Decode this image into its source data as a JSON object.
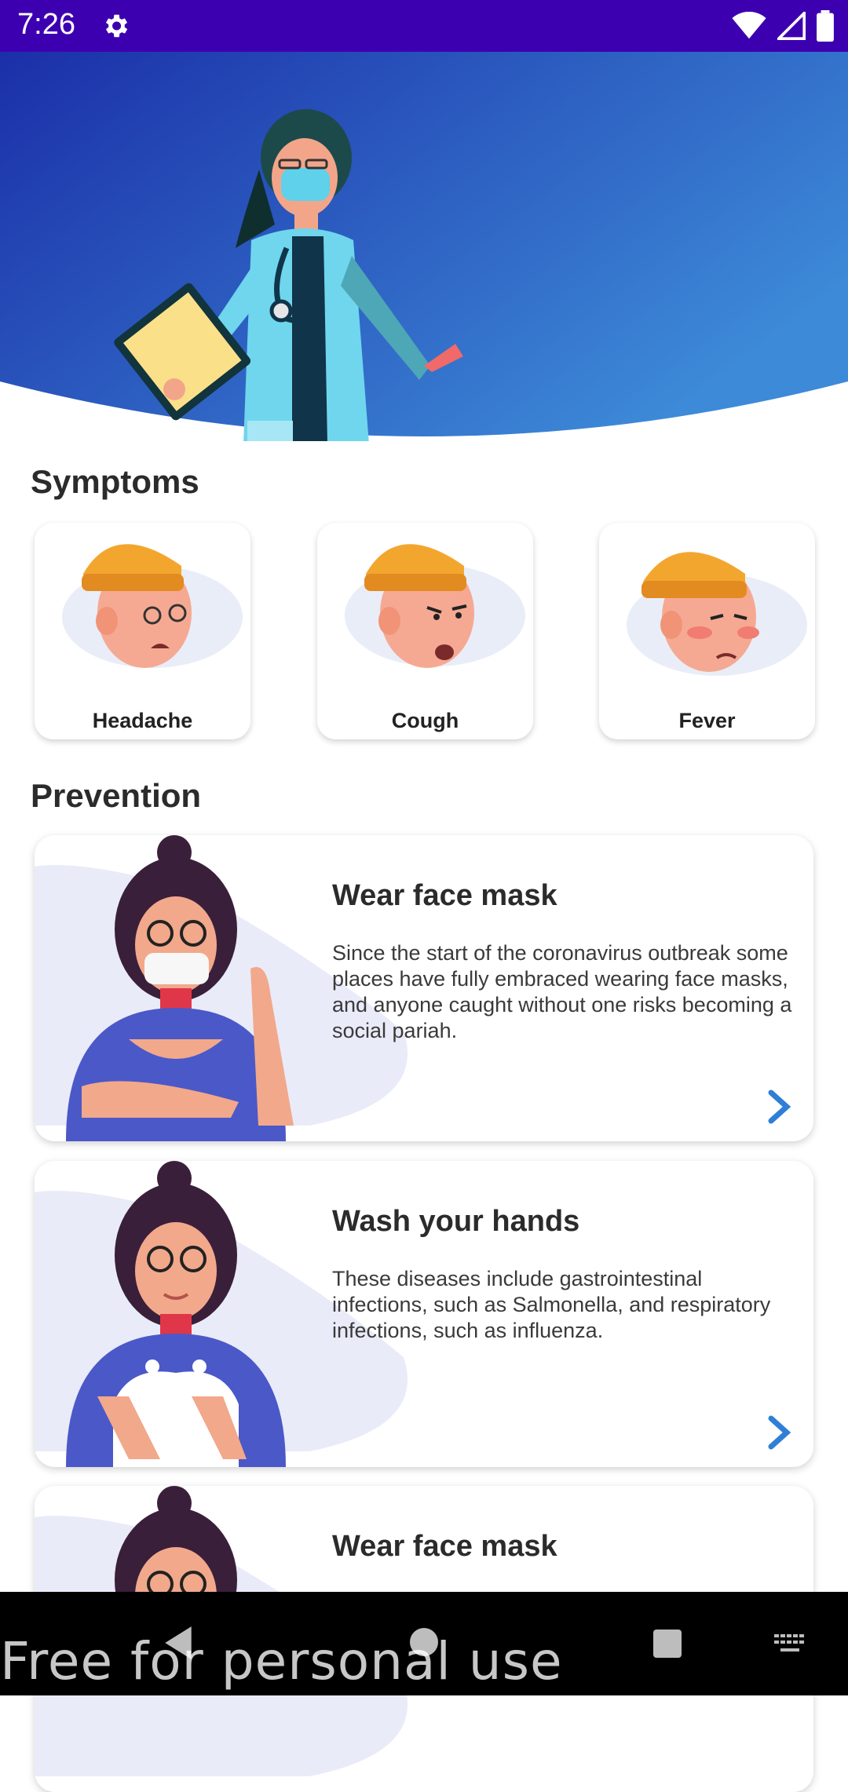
{
  "status_bar": {
    "time": "7:26",
    "icons": [
      "settings-gear-icon",
      "wifi-icon",
      "signal-icon",
      "battery-icon"
    ],
    "background": "#3d00b0"
  },
  "header": {
    "illustration": "doctor-with-clipboard-and-mask",
    "gradient": [
      "#1b2fa8",
      "#3d8ad8"
    ]
  },
  "symptoms": {
    "title": "Symptoms",
    "items": [
      {
        "label": "Headache",
        "illustration": "dizzy-face"
      },
      {
        "label": "Cough",
        "illustration": "coughing-face"
      },
      {
        "label": "Fever",
        "illustration": "feverish-face"
      }
    ]
  },
  "prevention": {
    "title": "Prevention",
    "items": [
      {
        "title": "Wear face mask",
        "text": "Since the start of the coronavirus outbreak some places have fully embraced wearing face masks, and anyone caught without one risks becoming a social pariah.",
        "illustration": "woman-wearing-mask-thumbs-up"
      },
      {
        "title": "Wash your hands",
        "text": "These diseases include gastrointestinal infections, such as Salmonella, and respiratory infections, such as influenza.",
        "illustration": "woman-washing-hands"
      },
      {
        "title": "Wear face mask",
        "text": "",
        "illustration": "woman-wearing-mask"
      }
    ],
    "accent": "#2f7fd6"
  },
  "nav_bar": {
    "icons": [
      "back-icon",
      "home-icon",
      "recents-icon",
      "keyboard-icon"
    ]
  },
  "watermark": "Free for personal use"
}
